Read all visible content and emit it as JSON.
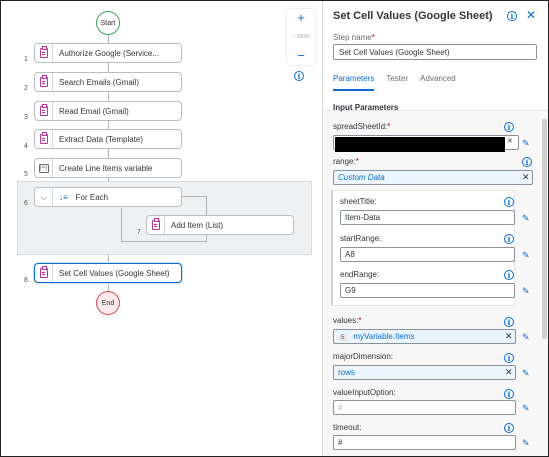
{
  "canvas": {
    "start_label": "Start",
    "end_label": "End",
    "zoom": {
      "plus": "+",
      "value": "100%",
      "minus": "−"
    },
    "steps": [
      {
        "num": "1",
        "label": "Authorize Google (Service..."
      },
      {
        "num": "2",
        "label": "Search Emails (Gmail)"
      },
      {
        "num": "3",
        "label": "Read Email (Gmail)"
      },
      {
        "num": "4",
        "label": "Extract Data (Template)"
      },
      {
        "num": "5",
        "label": "Create Line Items variable"
      },
      {
        "num": "6",
        "label": "For Each"
      },
      {
        "num": "7",
        "label": "Add Item (List)"
      },
      {
        "num": "8",
        "label": "Set Cell Values (Google Sheet)"
      }
    ]
  },
  "panel": {
    "title": "Set Cell Values (Google Sheet)",
    "step_name_label": "Step name",
    "step_name_value": "Set Cell Values (Google Sheet)",
    "tabs": [
      "Parameters",
      "Tester",
      "Advanced"
    ],
    "section_title": "Input Parameters",
    "fields": {
      "spreadsheet_id_label": "spreadSheetId:",
      "range_label": "range:",
      "range_value": "Custom Data",
      "sheet_title_label": "sheetTitle:",
      "sheet_title_value": "Item-Data",
      "start_range_label": "startRange:",
      "start_range_value": "A8",
      "end_range_label": "endRange:",
      "end_range_value": "G9",
      "values_label": "values:",
      "values_count": "5",
      "values_value": "myVariable.Items",
      "major_dimension_label": "majorDimension:",
      "major_dimension_value": "rows",
      "value_input_option_label": "valueInputOption:",
      "value_input_option_placeholder": "#",
      "timeout_label": "timeout:",
      "timeout_value": "#"
    }
  },
  "colors": {
    "accent": "#0a6ed1",
    "start": "#3aa552",
    "end": "#d64b4b",
    "activity": "#b8389a"
  }
}
